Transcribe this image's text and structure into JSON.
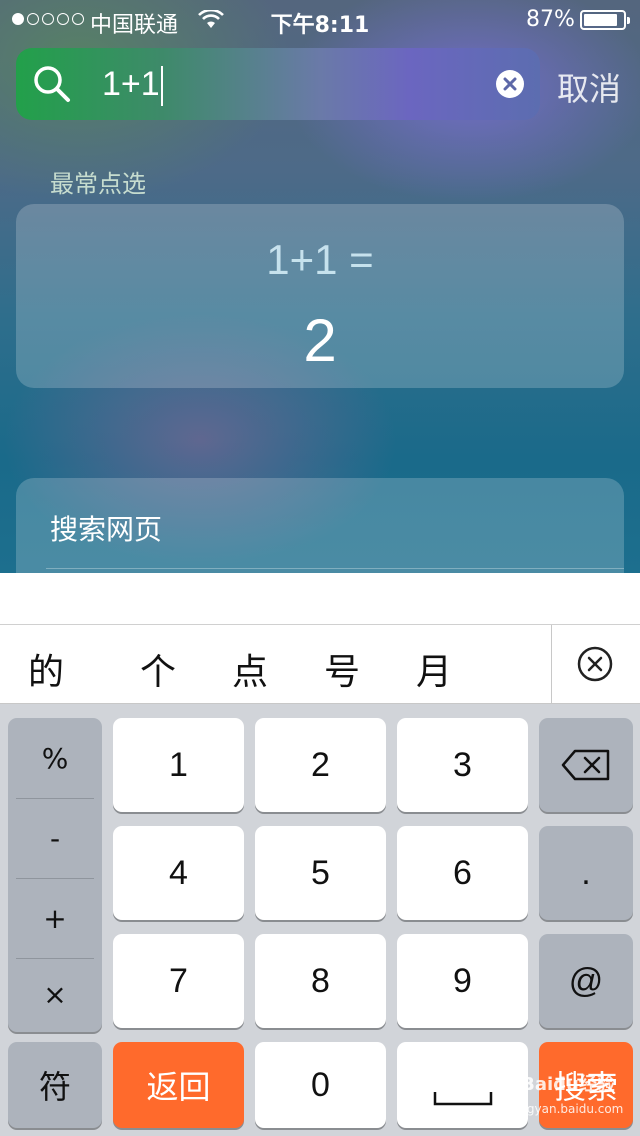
{
  "status_bar": {
    "signal_dots": 5,
    "signal_filled": 1,
    "carrier": "中国联通",
    "time": "下午8:11",
    "battery_percent": "87%",
    "battery_level": 0.87
  },
  "search": {
    "query": "1+1",
    "cancel_label": "取消"
  },
  "suggestions": {
    "section_title": "最常点选",
    "calculation": {
      "expression": "1+1 =",
      "result": "2"
    }
  },
  "web_search": {
    "label": "搜索网页"
  },
  "candidates": [
    "的",
    "个",
    "点",
    "号",
    "月"
  ],
  "keyboard": {
    "symbols": [
      "%",
      "-",
      "+",
      "×"
    ],
    "digits": [
      "1",
      "2",
      "3",
      "4",
      "5",
      "6",
      "7",
      "8",
      "9"
    ],
    "dot_key": ".",
    "at_key": "@",
    "symbols_toggle": "符",
    "return_label": "返回",
    "zero": "0",
    "search_label": "搜索"
  },
  "watermark": {
    "text": "Baidu经验",
    "url": "jingyan.baidu.com"
  },
  "colors": {
    "accent_orange": "#ff6a2c",
    "keyboard_bg": "#d1d4d9",
    "dark_key": "#adb3bc"
  }
}
